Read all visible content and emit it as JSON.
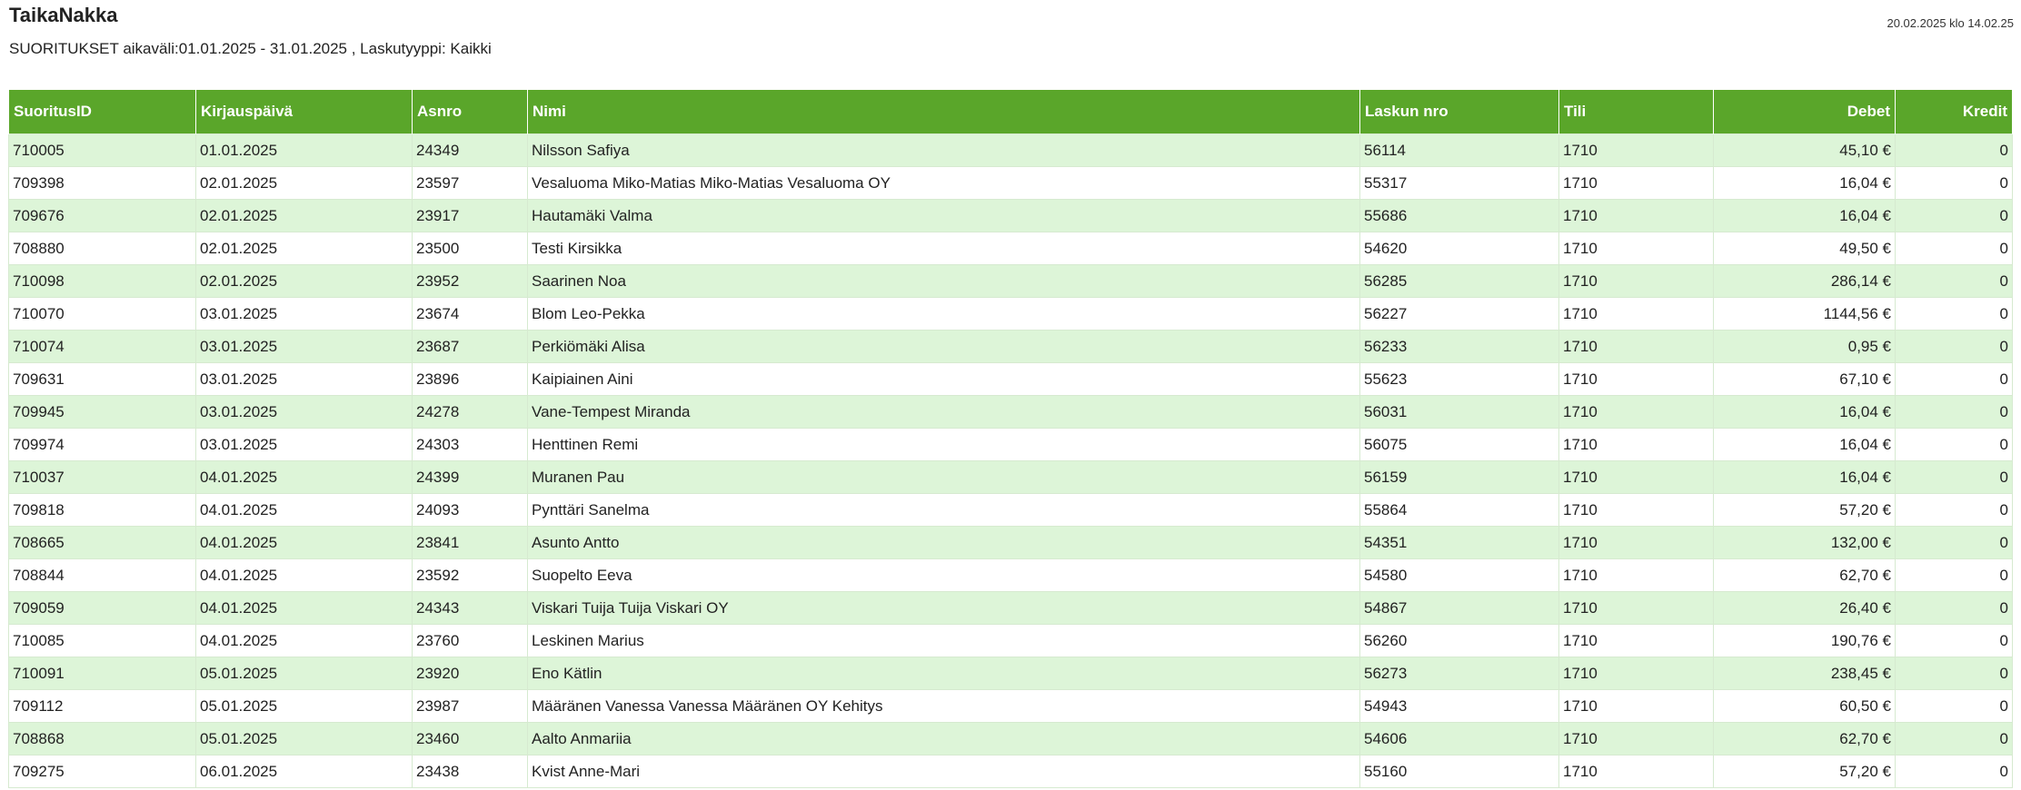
{
  "header": {
    "title": "TaikaNakka",
    "timestamp": "20.02.2025 klo 14.02.25",
    "subtitle": "SUORITUKSET aikaväli:01.01.2025 - 31.01.2025 , Laskutyyppi: Kaikki"
  },
  "table": {
    "columns": [
      "SuoritusID",
      "Kirjauspäivä",
      "Asnro",
      "Nimi",
      "Laskun nro",
      "Tili",
      "Debet",
      "Kredit"
    ],
    "rows": [
      [
        "710005",
        "01.01.2025",
        "24349",
        "Nilsson Safiya",
        "56114",
        "1710",
        "45,10 €",
        "0"
      ],
      [
        "709398",
        "02.01.2025",
        "23597",
        "Vesaluoma Miko-Matias Miko-Matias Vesaluoma OY",
        "55317",
        "1710",
        "16,04 €",
        "0"
      ],
      [
        "709676",
        "02.01.2025",
        "23917",
        "Hautamäki Valma",
        "55686",
        "1710",
        "16,04 €",
        "0"
      ],
      [
        "708880",
        "02.01.2025",
        "23500",
        "Testi Kirsikka",
        "54620",
        "1710",
        "49,50 €",
        "0"
      ],
      [
        "710098",
        "02.01.2025",
        "23952",
        "Saarinen Noa",
        "56285",
        "1710",
        "286,14 €",
        "0"
      ],
      [
        "710070",
        "03.01.2025",
        "23674",
        "Blom Leo-Pekka",
        "56227",
        "1710",
        "1144,56 €",
        "0"
      ],
      [
        "710074",
        "03.01.2025",
        "23687",
        "Perkiömäki Alisa",
        "56233",
        "1710",
        "0,95 €",
        "0"
      ],
      [
        "709631",
        "03.01.2025",
        "23896",
        "Kaipiainen Aini",
        "55623",
        "1710",
        "67,10 €",
        "0"
      ],
      [
        "709945",
        "03.01.2025",
        "24278",
        "Vane-Tempest Miranda",
        "56031",
        "1710",
        "16,04 €",
        "0"
      ],
      [
        "709974",
        "03.01.2025",
        "24303",
        "Henttinen Remi",
        "56075",
        "1710",
        "16,04 €",
        "0"
      ],
      [
        "710037",
        "04.01.2025",
        "24399",
        "Muranen Pau",
        "56159",
        "1710",
        "16,04 €",
        "0"
      ],
      [
        "709818",
        "04.01.2025",
        "24093",
        "Pynttäri Sanelma",
        "55864",
        "1710",
        "57,20 €",
        "0"
      ],
      [
        "708665",
        "04.01.2025",
        "23841",
        "Asunto Antto",
        "54351",
        "1710",
        "132,00 €",
        "0"
      ],
      [
        "708844",
        "04.01.2025",
        "23592",
        "Suopelto Eeva",
        "54580",
        "1710",
        "62,70 €",
        "0"
      ],
      [
        "709059",
        "04.01.2025",
        "24343",
        "Viskari Tuija Tuija Viskari OY",
        "54867",
        "1710",
        "26,40 €",
        "0"
      ],
      [
        "710085",
        "04.01.2025",
        "23760",
        "Leskinen Marius",
        "56260",
        "1710",
        "190,76 €",
        "0"
      ],
      [
        "710091",
        "05.01.2025",
        "23920",
        "Eno Kätlin",
        "56273",
        "1710",
        "238,45 €",
        "0"
      ],
      [
        "709112",
        "05.01.2025",
        "23987",
        "Määränen Vanessa Vanessa Määränen OY Kehitys",
        "54943",
        "1710",
        "60,50 €",
        "0"
      ],
      [
        "708868",
        "05.01.2025",
        "23460",
        "Aalto Anmariia",
        "54606",
        "1710",
        "62,70 €",
        "0"
      ],
      [
        "709275",
        "06.01.2025",
        "23438",
        "Kvist Anne-Mari",
        "55160",
        "1710",
        "57,20 €",
        "0"
      ]
    ]
  }
}
